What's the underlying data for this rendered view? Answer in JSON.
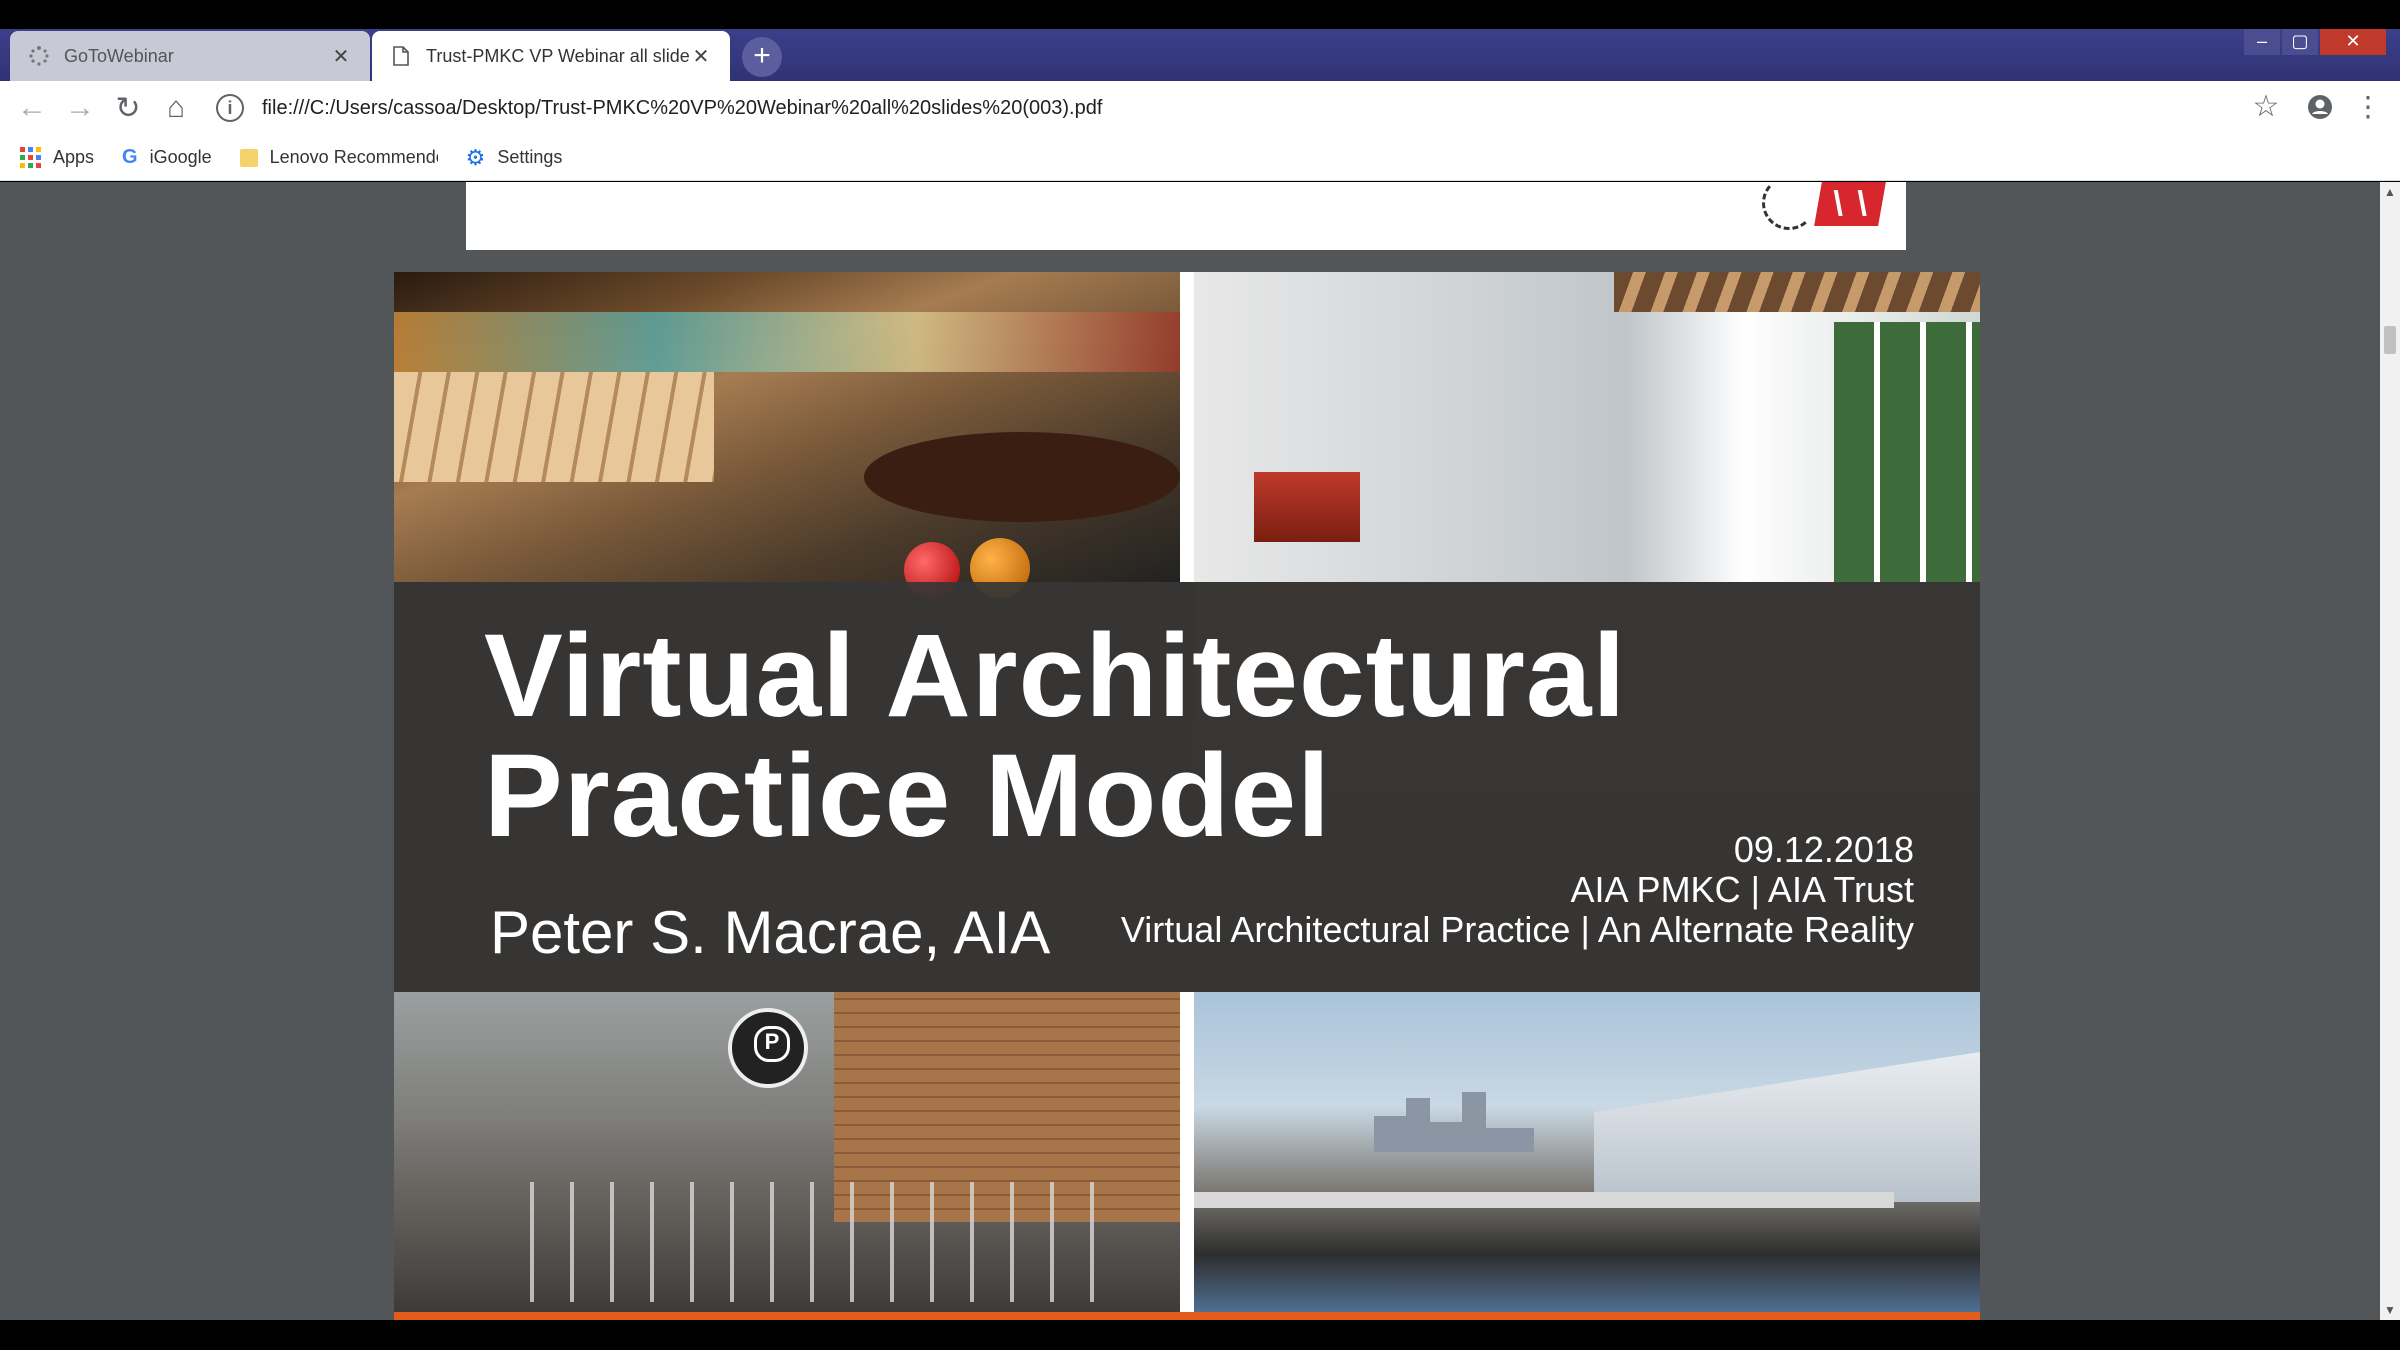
{
  "browser": {
    "tabs": [
      {
        "title": "GoToWebinar",
        "icon": "loading-spinner-icon",
        "active": false
      },
      {
        "title": "Trust-PMKC VP Webinar all slide",
        "icon": "document-icon",
        "active": true
      }
    ],
    "new_tab": "+",
    "window_controls": {
      "minimize": "–",
      "maximize": "▢",
      "close": "✕"
    },
    "nav": {
      "back": "←",
      "forward": "→",
      "reload": "↻",
      "home": "⌂"
    },
    "address": {
      "info": "i",
      "url": "file:///C:/Users/cassoa/Desktop/Trust-PMKC%20VP%20Webinar%20all%20slides%20(003).pdf"
    },
    "star": "☆",
    "menu": "⋮",
    "bookmarks": [
      {
        "label": "Apps",
        "icon": "apps-grid-icon"
      },
      {
        "label": "iGoogle",
        "icon": "google-icon",
        "glyph": "G"
      },
      {
        "label": "Lenovo Recommende",
        "icon": "folder-icon"
      },
      {
        "label": "Settings",
        "icon": "gear-icon",
        "glyph": "⚙"
      }
    ],
    "accent": "#3c3f8a"
  },
  "slide": {
    "title_line1": "Virtual Architectural",
    "title_line2": "Practice Model",
    "presenter": "Peter S. Macrae, AIA",
    "date": "09.12.2018",
    "org": "AIA PMKC | AIA Trust",
    "subtitle": "Virtual Architectural Practice | An Alternate Reality",
    "accent_bar": "#e25c1c"
  },
  "scroll": {
    "up": "▲",
    "down": "▼"
  }
}
